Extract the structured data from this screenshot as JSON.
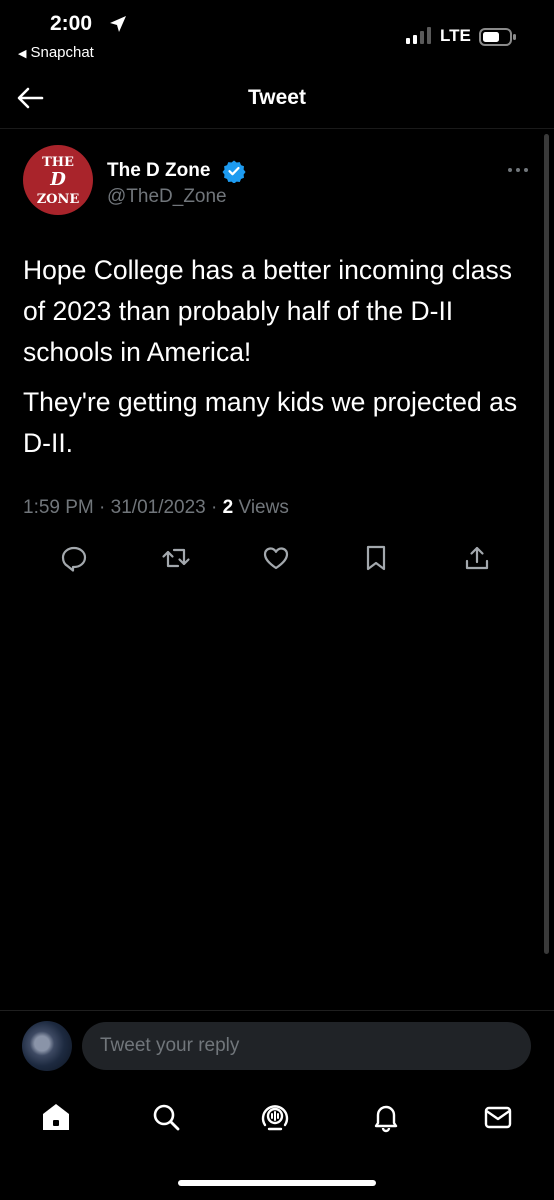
{
  "status_bar": {
    "time": "2:00",
    "back_app": "Snapchat",
    "network": "LTE"
  },
  "header": {
    "title": "Tweet"
  },
  "tweet": {
    "avatar_text": [
      "THE",
      "D",
      "ZONE"
    ],
    "author_name": "The D Zone",
    "author_handle": "@TheD_Zone",
    "paragraphs": [
      "Hope College has a better incoming class of 2023 than probably half of the D-II schools in America!",
      "They're getting many kids we projected as D-II."
    ],
    "time": "1:59 PM",
    "date": "31/01/2023",
    "views_count": "2",
    "views_label": "Views",
    "actions": [
      "reply-icon",
      "retweet-icon",
      "like-icon",
      "bookmark-icon",
      "share-icon"
    ]
  },
  "reply": {
    "placeholder": "Tweet your reply"
  },
  "tab_bar": {
    "items": [
      "home-icon",
      "search-icon",
      "spaces-icon",
      "notifications-icon",
      "messages-icon"
    ]
  },
  "colors": {
    "background": "#000000",
    "text": "#ffffff",
    "secondary_text": "#71767b",
    "verified": "#1d9bf0",
    "avatar_red": "#a9242b",
    "input_bg": "#202327"
  }
}
